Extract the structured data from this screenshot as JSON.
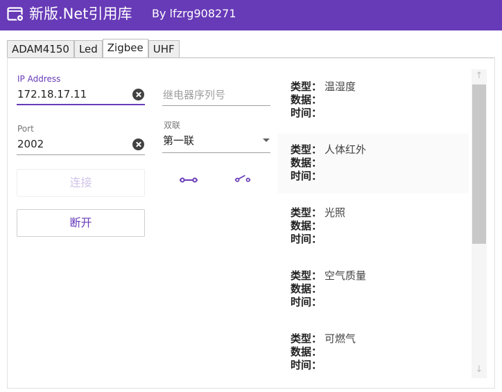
{
  "app": {
    "title": "新版.Net引用库",
    "author": "By lfzrg908271",
    "accent": "#673ab7"
  },
  "tabs": [
    "ADAM4150",
    "Led",
    "Zigbee",
    "UHF"
  ],
  "active_tab": "Zigbee",
  "connection": {
    "ip_label": "IP Address",
    "ip_value": "172.18.17.11",
    "port_label": "Port",
    "port_value": "2002",
    "connect_label": "连接",
    "disconnect_label": "断开"
  },
  "relay": {
    "serial_placeholder": "继电器序列号",
    "dual_label": "双联",
    "dual_value": "第一联",
    "on_icon": "switch-closed-icon",
    "off_icon": "switch-open-icon"
  },
  "sensors": [
    {
      "type_key": "类型：",
      "type_value": "温湿度",
      "data_key": "数据：",
      "data_value": "",
      "time_key": "时间：",
      "time_value": ""
    },
    {
      "type_key": "类型：",
      "type_value": "人体红外",
      "data_key": "数据：",
      "data_value": "",
      "time_key": "时间：",
      "time_value": ""
    },
    {
      "type_key": "类型：",
      "type_value": "光照",
      "data_key": "数据：",
      "data_value": "",
      "time_key": "时间：",
      "time_value": ""
    },
    {
      "type_key": "类型：",
      "type_value": "空气质量",
      "data_key": "数据：",
      "data_value": "",
      "time_key": "时间：",
      "time_value": ""
    },
    {
      "type_key": "类型：",
      "type_value": "可燃气",
      "data_key": "数据：",
      "data_value": "",
      "time_key": "时间：",
      "time_value": ""
    }
  ],
  "scrollbar": {
    "up_icon": "arrow-up-icon",
    "down_icon": "arrow-down-icon"
  }
}
